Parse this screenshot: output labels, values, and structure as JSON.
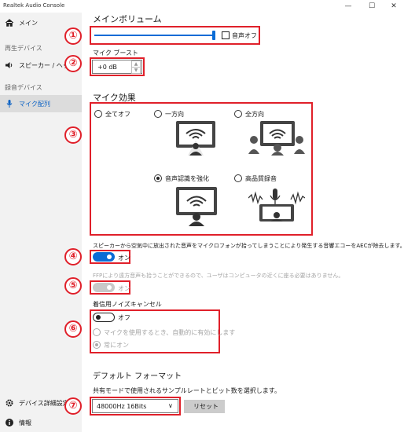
{
  "window": {
    "title": "Realtek Audio Console",
    "min": "—",
    "max": "☐",
    "close": "✕"
  },
  "sidebar": {
    "home": "メイン",
    "section_playback": "再生デバイス",
    "speaker": "スピーカー / ヘッドフォン",
    "section_record": "録音デバイス",
    "mic": "マイク配列",
    "advanced": "デバイス詳細設定",
    "info": "情報"
  },
  "main": {
    "volume_title": "メインボリューム",
    "volume_level": 1.0,
    "mute_label": "音声オフ",
    "boost_label": "マイク ブースト",
    "boost_value": "+0 dB",
    "effects_title": "マイク効果",
    "effects": [
      {
        "label": "全てオフ",
        "selected": false
      },
      {
        "label": "一方向",
        "selected": false
      },
      {
        "label": "全方向",
        "selected": false
      },
      {
        "label": "音声認識を強化",
        "selected": true
      },
      {
        "label": "高品質録音",
        "selected": false
      }
    ],
    "aec_desc": "スピーカーから空気中に放出された音声をマイクロフォンが拾ってしまうことにより発生する音響エコーをAECが除去します。",
    "aec_toggle": "オン",
    "ffp_desc": "FFPにより遠方音声も拾うことができるので、ユーザはコンピュータの近くに座る必要はありません。",
    "ffp_toggle": "オン",
    "noise_title": "着信用ノイズキャンセル",
    "noise_toggle": "オフ",
    "noise_opt1": "マイクを使用するとき、自動的に有効にします",
    "noise_opt2": "常にオン",
    "format_title": "デフォルト フォーマット",
    "format_desc": "共有モードで使用されるサンプルレートとビット数を選択します。",
    "format_value": "48000Hz 16Bits",
    "reset_label": "リセット"
  },
  "annotations": [
    "①",
    "②",
    "③",
    "④",
    "⑤",
    "⑥",
    "⑦"
  ],
  "colors": {
    "accent": "#0a6cd6",
    "highlight": "#e0202a",
    "toggle_off_knob": "#222222"
  }
}
